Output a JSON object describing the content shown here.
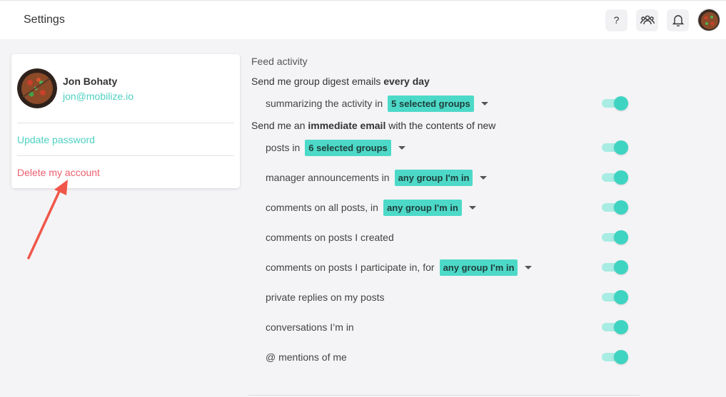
{
  "header": {
    "title": "Settings",
    "icons": [
      "help-icon",
      "groups-icon",
      "bell-icon",
      "profile-avatar"
    ],
    "help_glyph": "?"
  },
  "profile": {
    "name": "Jon Bohaty",
    "email": "jon@mobilize.io",
    "update_password": "Update password",
    "delete_account": "Delete my account"
  },
  "feed": {
    "section_title": "Feed activity",
    "digest_heading": {
      "pre": "Send me group digest emails ",
      "bold": "every day"
    },
    "digest_rows": [
      {
        "label": "summarizing the activity in",
        "pill": "5 selected groups",
        "enabled": true
      }
    ],
    "immediate_heading": {
      "pre": "Send me an ",
      "bold": "immediate email",
      "post": " with the contents of new"
    },
    "immediate_rows": [
      {
        "label": "posts in",
        "pill": "6 selected groups",
        "enabled": true
      },
      {
        "label": "manager announcements in",
        "pill": "any group I'm in",
        "enabled": true
      },
      {
        "label": "comments on all posts, in",
        "pill": "any group I'm in",
        "enabled": true
      },
      {
        "label": "comments on posts I created",
        "pill": "",
        "enabled": true
      },
      {
        "label": "comments on posts I participate in, for",
        "pill": "any group I'm in",
        "enabled": true
      },
      {
        "label": "private replies on my posts",
        "pill": "",
        "enabled": true
      },
      {
        "label": "conversations I’m in",
        "pill": "",
        "enabled": true
      },
      {
        "label": "@ mentions of me",
        "pill": "",
        "enabled": true
      }
    ]
  },
  "colors": {
    "accent": "#4dd9c8",
    "link": "#4dd0c1",
    "danger": "#ec5f6e",
    "arrow": "#f0574a"
  }
}
